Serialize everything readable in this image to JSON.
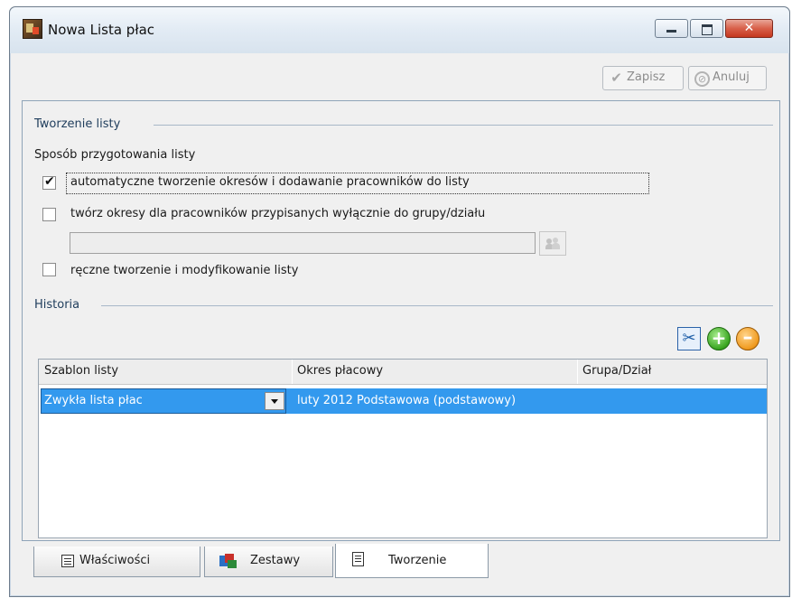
{
  "window": {
    "title": "Nowa Lista płac",
    "controls": {
      "minimize": "–",
      "maximize": "□",
      "close": "✕"
    }
  },
  "toolbar": {
    "save_label": "Zapisz",
    "cancel_label": "Anuluj",
    "save_icon": "checkmark-icon",
    "cancel_icon": "cancel-circle-icon",
    "enabled": false
  },
  "creation": {
    "section_title": "Tworzenie listy",
    "method_label": "Sposób przygotowania listy",
    "options": [
      {
        "label": "automatyczne tworzenie okresów i dodawanie pracowników do listy",
        "checked": true
      },
      {
        "label": "twórz okresy dla pracowników przypisanych wyłącznie do grupy/działu",
        "checked": false
      },
      {
        "label": "ręczne tworzenie i modyfikowanie listy",
        "checked": false
      }
    ],
    "group_field_value": ""
  },
  "history": {
    "section_title": "Historia",
    "tools": [
      "settings-icon",
      "add-icon",
      "remove-icon"
    ],
    "columns": [
      "Szablon listy",
      "Okres płacowy",
      "Grupa/Dział"
    ],
    "rows": [
      {
        "template": "Zwykła lista płac",
        "period": "luty 2012 Podstawowa (podstawowy)",
        "group": ""
      }
    ]
  },
  "tabs": [
    {
      "label": "Właściwości",
      "icon": "properties-icon",
      "active": false
    },
    {
      "label": "Zestawy",
      "icon": "sets-icon",
      "active": false
    },
    {
      "label": "Tworzenie",
      "icon": "document-icon",
      "active": true
    }
  ],
  "colors": {
    "selection": "#3399ee",
    "section_text": "#1f3d5c",
    "close_button": "#d8604a"
  }
}
